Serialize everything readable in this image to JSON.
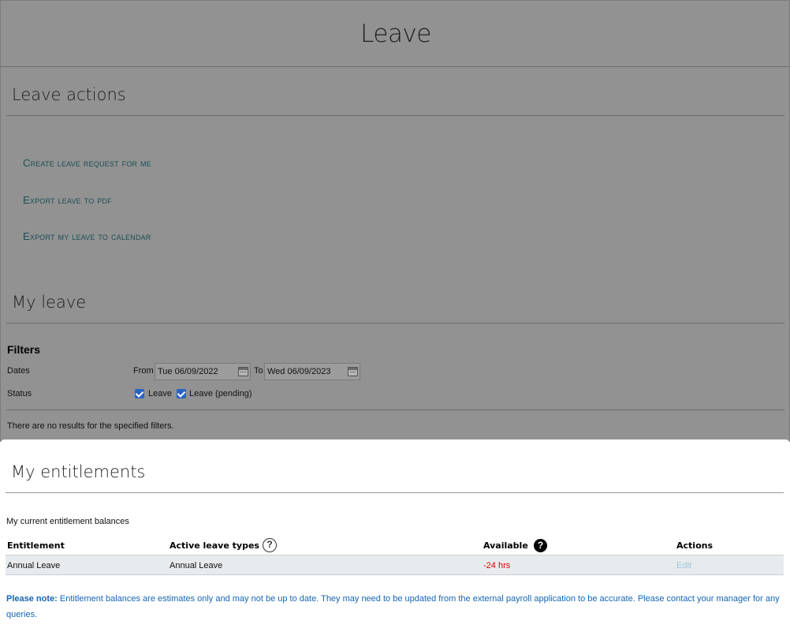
{
  "page": {
    "title": "Leave"
  },
  "leave_actions": {
    "heading": "Leave actions",
    "links": [
      {
        "label": "Create leave request for me"
      },
      {
        "label": "Export leave to pdf"
      },
      {
        "label": "Export my leave to calendar"
      }
    ]
  },
  "my_leave": {
    "heading": "My leave",
    "filters": {
      "title": "Filters",
      "dates_label": "Dates",
      "from_label": "From",
      "from_value": "Tue 06/09/2022",
      "to_label": "To",
      "to_value": "Wed 06/09/2023",
      "status_label": "Status",
      "status_options": [
        {
          "label": "Leave",
          "checked": true
        },
        {
          "label": "Leave (pending)",
          "checked": true
        }
      ]
    },
    "no_results": "There are no results for the specified filters."
  },
  "entitlements": {
    "heading": "My entitlements",
    "subtitle": "My current entitlement balances",
    "columns": {
      "entitlement": "Entitlement",
      "active_leave_types": "Active leave types",
      "available": "Available",
      "actions": "Actions"
    },
    "rows": [
      {
        "entitlement": "Annual Leave",
        "active_leave_types": "Annual Leave",
        "available": "-24 hrs",
        "action": "Edit"
      }
    ],
    "note_label": "Please note:",
    "note_text": "Entitlement balances are estimates only and may not be up to date. They may need to be updated from the external payroll application to be accurate. Please contact your manager for any queries."
  },
  "colors": {
    "overlay": "#929292",
    "link": "#1a4f55",
    "negative": "#e00000",
    "note": "#1565b4",
    "checkbox": "#2b63c1"
  },
  "icons": [
    "calendar-icon",
    "help-outline-icon",
    "help-solid-icon",
    "checkbox-checked-icon"
  ]
}
